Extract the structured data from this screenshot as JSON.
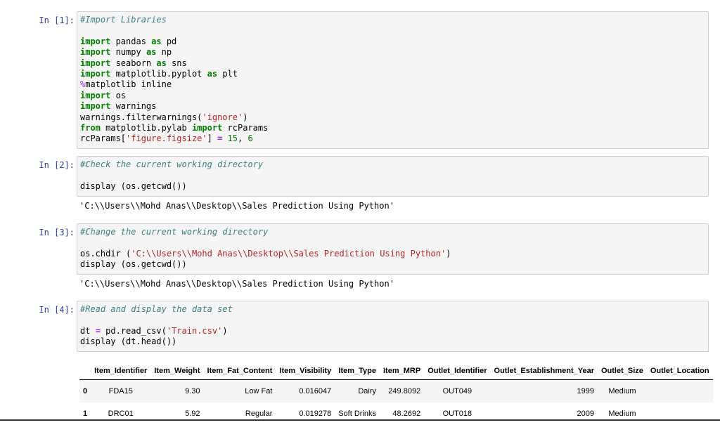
{
  "cells": [
    {
      "prompt": "In [1]:",
      "comment": "#Import Libraries",
      "lines": [
        {
          "k1": "import",
          "t1": " pandas ",
          "k2": "as",
          "t2": " pd"
        },
        {
          "k1": "import",
          "t1": " numpy ",
          "k2": "as",
          "t2": " np"
        },
        {
          "k1": "import",
          "t1": " seaborn ",
          "k2": "as",
          "t2": " sns"
        },
        {
          "k1": "import",
          "t1": " matplotlib.pyplot ",
          "k2": "as",
          "t2": " plt"
        }
      ],
      "magic_pct": "%",
      "magic_rest": "matplotlib inline",
      "import_os_kw": "import",
      "import_os": " os",
      "import_warn_kw": "import",
      "import_warn": " warnings",
      "filter_pre": "warnings.filterwarnings(",
      "filter_str": "'ignore'",
      "filter_post": ")",
      "from_kw": "from",
      "from_mod": " matplotlib.pylab ",
      "from_import_kw": "import",
      "from_name": " rcParams",
      "rc_pre": "rcParams[",
      "rc_str": "'figure.figsize'",
      "rc_mid": "] ",
      "rc_eq": "=",
      "rc_n1": " 15",
      "rc_comma": ",",
      "rc_n2": " 6"
    },
    {
      "prompt": "In [2]:",
      "comment": "#Check the current working directory",
      "code": "display (os.getcwd())",
      "output": "'C:\\\\Users\\\\Mohd Anas\\\\Desktop\\\\Sales Prediction Using Python'"
    },
    {
      "prompt": "In [3]:",
      "comment": "#Change the current working directory",
      "code_pre": "os.chdir (",
      "code_str": "'C:\\\\Users\\\\Mohd Anas\\\\Desktop\\\\Sales Prediction Using Python'",
      "code_post": ")",
      "code2": "display (os.getcwd())",
      "output": "'C:\\\\Users\\\\Mohd Anas\\\\Desktop\\\\Sales Prediction Using Python'"
    },
    {
      "prompt": "In [4]:",
      "comment": "#Read and display the data set",
      "code_pre": "dt ",
      "code_eq": "=",
      "code_mid": " pd.read_csv(",
      "code_str": "'Train.csv'",
      "code_post": ")",
      "code2": "display (dt.head())"
    }
  ],
  "table": {
    "columns": [
      "",
      "Item_Identifier",
      "Item_Weight",
      "Item_Fat_Content",
      "Item_Visibility",
      "Item_Type",
      "Item_MRP",
      "Outlet_Identifier",
      "Outlet_Establishment_Year",
      "Outlet_Size",
      "Outlet_Location"
    ],
    "rows": [
      [
        "0",
        "FDA15",
        "9.30",
        "Low Fat",
        "0.016047",
        "Dairy",
        "249.8092",
        "OUT049",
        "1999",
        "Medium",
        ""
      ],
      [
        "1",
        "DRC01",
        "5.92",
        "Regular",
        "0.019278",
        "Soft Drinks",
        "48.2692",
        "OUT018",
        "2009",
        "Medium",
        ""
      ]
    ]
  }
}
